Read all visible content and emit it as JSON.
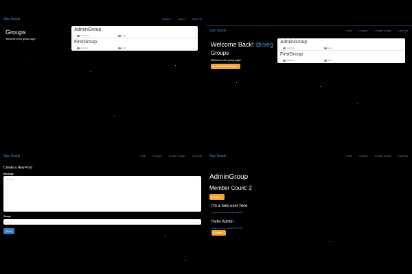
{
  "brand": "Star Social",
  "panel1": {
    "nav_links": [
      "Groups",
      "Log In",
      "Sign Up"
    ],
    "title": "Groups",
    "subtitle": "Welcome to the group page!",
    "groups": [
      {
        "name": "AdminGroup",
        "members_count": "2",
        "members_label": "members",
        "posts_count": "2",
        "posts_label": "posts"
      },
      {
        "name": "FirstGroup",
        "members_count": "1",
        "members_label": "member",
        "posts_count": "0",
        "posts_label": "post"
      }
    ]
  },
  "panel2": {
    "nav_links": [
      "Post",
      "Groups",
      "Create Group",
      "Log Out"
    ],
    "welcome_prefix": "Welcome Back!",
    "username": "@oleg",
    "title": "Groups",
    "subtitle": "Welcome to the group page!",
    "create_group_label": "Create New Group!",
    "groups": [
      {
        "name": "AdminGroup",
        "members_count": "2",
        "members_label": "members",
        "posts_count": "2",
        "posts_label": "posts"
      },
      {
        "name": "FirstGroup",
        "members_count": "1",
        "members_label": "member",
        "posts_count": "0",
        "posts_label": "post"
      }
    ]
  },
  "panel3": {
    "nav_links": [
      "Post",
      "Groups",
      "Create Group",
      "Log Out"
    ],
    "title": "Create a New Post",
    "message_label": "Message",
    "message_placeholder": "Message",
    "group_label": "Group",
    "group_placeholder": "---------",
    "post_button": "Post"
  },
  "panel4": {
    "nav_links": [
      "Post",
      "Groups",
      "Create Group",
      "Log Out"
    ],
    "group_name": "AdminGroup",
    "member_count": "Member Count: 2",
    "leave_label": "Leave",
    "posts": [
      {
        "text": "I'm a new user here",
        "meta": "@oleg Mon Sep 23 2024 16:42:51"
      },
      {
        "text": "Hello Admin",
        "meta": "@oleg Tue Sep 24 2024 16:29:38",
        "delete_label": "Delete"
      }
    ]
  }
}
